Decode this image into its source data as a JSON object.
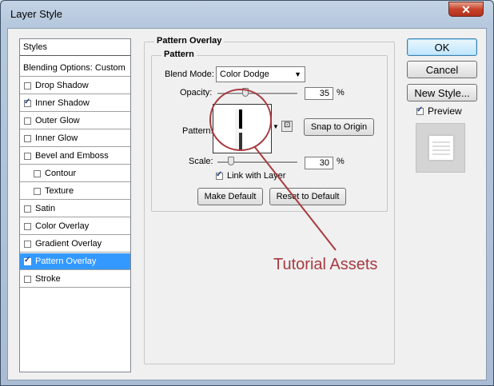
{
  "window": {
    "title": "Layer Style",
    "close_glyph": "✕"
  },
  "sidebar": {
    "header": "Styles",
    "blending": "Blending Options: Custom",
    "items": [
      {
        "label": "Drop Shadow",
        "checked": false,
        "indent": false,
        "selected": false
      },
      {
        "label": "Inner Shadow",
        "checked": true,
        "indent": false,
        "selected": false
      },
      {
        "label": "Outer Glow",
        "checked": false,
        "indent": false,
        "selected": false
      },
      {
        "label": "Inner Glow",
        "checked": false,
        "indent": false,
        "selected": false
      },
      {
        "label": "Bevel and Emboss",
        "checked": false,
        "indent": false,
        "selected": false
      },
      {
        "label": "Contour",
        "checked": false,
        "indent": true,
        "selected": false
      },
      {
        "label": "Texture",
        "checked": false,
        "indent": true,
        "selected": false
      },
      {
        "label": "Satin",
        "checked": false,
        "indent": false,
        "selected": false
      },
      {
        "label": "Color Overlay",
        "checked": false,
        "indent": false,
        "selected": false
      },
      {
        "label": "Gradient Overlay",
        "checked": false,
        "indent": false,
        "selected": false
      },
      {
        "label": "Pattern Overlay",
        "checked": true,
        "indent": false,
        "selected": true
      },
      {
        "label": "Stroke",
        "checked": false,
        "indent": false,
        "selected": false
      }
    ]
  },
  "panel": {
    "group_title": "Pattern Overlay",
    "subgroup_title": "Pattern",
    "blend_mode_label": "Blend Mode:",
    "blend_mode_value": "Color Dodge",
    "opacity_label": "Opacity:",
    "opacity_value": "35",
    "opacity_fraction": 0.35,
    "percent": "%",
    "pattern_label": "Pattern:",
    "snap_button": "Snap to Origin",
    "scale_label": "Scale:",
    "scale_value": "30",
    "scale_fraction": 0.3,
    "link_label": "Link with Layer",
    "link_checked": true,
    "make_default": "Make Default",
    "reset_default": "Reset to Default"
  },
  "right": {
    "ok": "OK",
    "cancel": "Cancel",
    "new_style": "New Style...",
    "preview_label": "Preview",
    "preview_checked": true
  },
  "annotation": {
    "text": "Tutorial Assets",
    "color": "#a83a3f"
  }
}
